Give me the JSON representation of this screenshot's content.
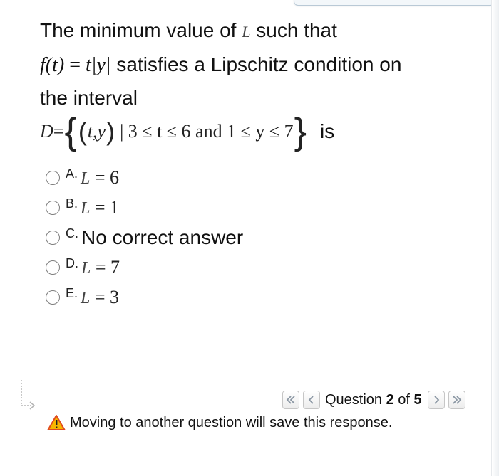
{
  "question": {
    "line1_text": "The minimum value of",
    "line1_var": "L",
    "line1_tail": "such that",
    "func_lhs": "f(t)",
    "func_eq": " = ",
    "func_rhs": "t|y|",
    "line2_tail": "satisfies a Lipschitz condition on",
    "line3": "the interval",
    "set_D": "D",
    "set_eq": " = ",
    "set_pair": "t,y",
    "set_cond": "| 3 ≤ t ≤ 6  and  1 ≤ y ≤ 7",
    "is_word": "is"
  },
  "options": [
    {
      "letter": "A.",
      "var": "L",
      "expr": " = 6"
    },
    {
      "letter": "B.",
      "var": "L",
      "expr": " = 1"
    },
    {
      "letter": "C.",
      "text": "No correct answer"
    },
    {
      "letter": "D.",
      "var": "L",
      "expr": " = 7"
    },
    {
      "letter": "E.",
      "var": "L",
      "expr": " = 3"
    }
  ],
  "navigation": {
    "first_icon": "double-chevron-left-icon",
    "prev_icon": "chevron-left-icon",
    "label_prefix": "Question ",
    "current": "2",
    "label_mid": " of ",
    "total": "5",
    "next_icon": "chevron-right-icon",
    "last_icon": "double-chevron-right-icon"
  },
  "notice": {
    "icon": "warning-icon",
    "text": "Moving to another question will save this response."
  },
  "colors": {
    "warning_fill": "#f7b500",
    "warning_stroke": "#e04a1f",
    "nav_arrow": "#8a96a3"
  }
}
